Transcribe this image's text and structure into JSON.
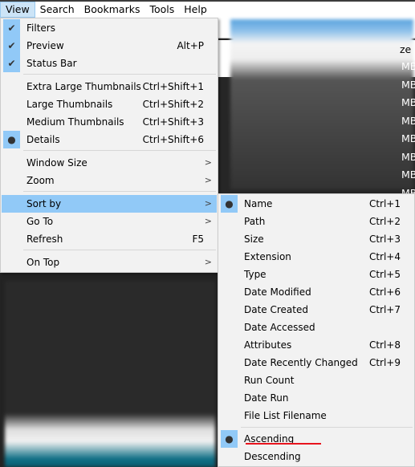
{
  "menubar": {
    "items": [
      "View",
      "Search",
      "Bookmarks",
      "Tools",
      "Help"
    ],
    "active": "View"
  },
  "background": {
    "column_header_fragment": "ze",
    "size_fragments": [
      "MB",
      "MB",
      "MB",
      "MB",
      "MB",
      "MB",
      "MB",
      "MB",
      "MB"
    ]
  },
  "view_menu": {
    "items": [
      {
        "label": "Filters",
        "checked": true,
        "mark": "check-icon"
      },
      {
        "label": "Preview",
        "shortcut": "Alt+P",
        "checked": true,
        "mark": "check-icon"
      },
      {
        "label": "Status Bar",
        "checked": true,
        "mark": "check-icon"
      },
      {
        "label": "Extra Large Thumbnails",
        "shortcut": "Ctrl+Shift+1"
      },
      {
        "label": "Large Thumbnails",
        "shortcut": "Ctrl+Shift+2"
      },
      {
        "label": "Medium Thumbnails",
        "shortcut": "Ctrl+Shift+3"
      },
      {
        "label": "Details",
        "shortcut": "Ctrl+Shift+6",
        "selected": true,
        "mark": "bullet-icon"
      },
      {
        "label": "Window Size",
        "submenu": true
      },
      {
        "label": "Zoom",
        "submenu": true
      },
      {
        "label": "Sort by",
        "submenu": true,
        "highlighted": true
      },
      {
        "label": "Go To",
        "submenu": true
      },
      {
        "label": "Refresh",
        "shortcut": "F5"
      },
      {
        "label": "On Top",
        "submenu": true
      }
    ]
  },
  "sort_menu": {
    "items": [
      {
        "label": "Name",
        "shortcut": "Ctrl+1",
        "selected": true
      },
      {
        "label": "Path",
        "shortcut": "Ctrl+2"
      },
      {
        "label": "Size",
        "shortcut": "Ctrl+3"
      },
      {
        "label": "Extension",
        "shortcut": "Ctrl+4"
      },
      {
        "label": "Type",
        "shortcut": "Ctrl+5"
      },
      {
        "label": "Date Modified",
        "shortcut": "Ctrl+6"
      },
      {
        "label": "Date Created",
        "shortcut": "Ctrl+7"
      },
      {
        "label": "Date Accessed"
      },
      {
        "label": "Attributes",
        "shortcut": "Ctrl+8"
      },
      {
        "label": "Date Recently Changed",
        "shortcut": "Ctrl+9"
      },
      {
        "label": "Run Count"
      },
      {
        "label": "Date Run"
      },
      {
        "label": "File List Filename"
      },
      {
        "label": "Ascending",
        "selected": true,
        "annotated_underline": "#e8141e"
      },
      {
        "label": "Descending"
      }
    ]
  },
  "colors": {
    "highlight": "#91c9f7",
    "menu_bg": "#f2f2f2",
    "annotation": "#e8141e"
  }
}
